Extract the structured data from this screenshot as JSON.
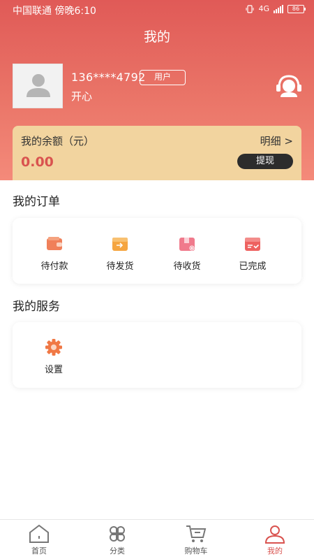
{
  "status_bar": {
    "carrier": "中国联通 傍晚6:10",
    "network": "4G",
    "battery": "86"
  },
  "header": {
    "title": "我的"
  },
  "profile": {
    "phone": "136****4792",
    "role": "用户",
    "nickname": "开心"
  },
  "balance": {
    "label": "我的余额（元）",
    "detail": "明细 >",
    "amount": "0.00",
    "withdraw": "提现"
  },
  "orders": {
    "title": "我的订单",
    "items": [
      {
        "label": "待付款",
        "icon": "wallet-icon"
      },
      {
        "label": "待发货",
        "icon": "ship-box-icon"
      },
      {
        "label": "待收货",
        "icon": "receive-box-icon"
      },
      {
        "label": "已完成",
        "icon": "completed-box-icon"
      }
    ]
  },
  "services": {
    "title": "我的服务",
    "items": [
      {
        "label": "设置",
        "icon": "gear-icon"
      }
    ]
  },
  "tabbar": {
    "items": [
      {
        "label": "首页",
        "icon": "home-icon"
      },
      {
        "label": "分类",
        "icon": "category-icon"
      },
      {
        "label": "购物车",
        "icon": "cart-icon"
      },
      {
        "label": "我的",
        "icon": "user-icon",
        "active": true
      }
    ]
  },
  "colors": {
    "header": "#e05a57",
    "balance_card": "#f2d49f",
    "accent": "#d9534f",
    "withdraw_button": "#2c2c2c"
  }
}
